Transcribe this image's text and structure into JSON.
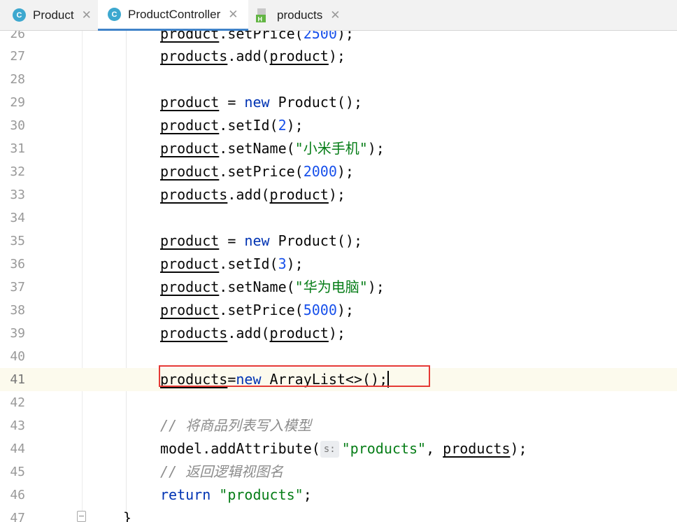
{
  "tabs": [
    {
      "label": "Product",
      "icon": "class-icon",
      "icon_letter": "C",
      "close": "✕"
    },
    {
      "label": "ProductController",
      "icon": "class-icon",
      "icon_letter": "C",
      "close": "✕"
    },
    {
      "label": "products",
      "icon": "html-file-icon",
      "icon_letter": "H",
      "close": "✕"
    }
  ],
  "active_tab": "ProductController",
  "lines": {
    "l26": {
      "no": "26",
      "a": "product",
      "b": ".setPrice(",
      "c": "2500",
      "d": ");"
    },
    "l27": {
      "no": "27",
      "a": "products",
      "b": ".add(",
      "c": "product",
      "d": ");"
    },
    "l28": {
      "no": "28"
    },
    "l29": {
      "no": "29",
      "a": "product",
      "b": " = ",
      "kw": "new",
      "c": " Product();"
    },
    "l30": {
      "no": "30",
      "a": "product",
      "b": ".setId(",
      "c": "2",
      "d": ");"
    },
    "l31": {
      "no": "31",
      "a": "product",
      "b": ".setName(",
      "c": "\"小米手机\"",
      "d": ");"
    },
    "l32": {
      "no": "32",
      "a": "product",
      "b": ".setPrice(",
      "c": "2000",
      "d": ");"
    },
    "l33": {
      "no": "33",
      "a": "products",
      "b": ".add(",
      "c": "product",
      "d": ");"
    },
    "l34": {
      "no": "34"
    },
    "l35": {
      "no": "35",
      "a": "product",
      "b": " = ",
      "kw": "new",
      "c": " Product();"
    },
    "l36": {
      "no": "36",
      "a": "product",
      "b": ".setId(",
      "c": "3",
      "d": ");"
    },
    "l37": {
      "no": "37",
      "a": "product",
      "b": ".setName(",
      "c": "\"华为电脑\"",
      "d": ");"
    },
    "l38": {
      "no": "38",
      "a": "product",
      "b": ".setPrice(",
      "c": "5000",
      "d": ");"
    },
    "l39": {
      "no": "39",
      "a": "products",
      "b": ".add(",
      "c": "product",
      "d": ");"
    },
    "l40": {
      "no": "40"
    },
    "l41": {
      "no": "41",
      "a": "products",
      "b": "=",
      "kw": "new",
      "c": " ArrayList<>();"
    },
    "l42": {
      "no": "42"
    },
    "l43": {
      "no": "43",
      "comment": "// 将商品列表写入模型"
    },
    "l44": {
      "no": "44",
      "a": "model.addAttribute(",
      "hint": "s:",
      "str": "\"products\"",
      "b": ", ",
      "c": "products",
      "d": ");"
    },
    "l45": {
      "no": "45",
      "comment": "// 返回逻辑视图名"
    },
    "l46": {
      "no": "46",
      "kw": "return",
      "str": "\"products\"",
      "d": ";"
    },
    "l47": {
      "no": "47",
      "brace": "}"
    }
  },
  "colors": {
    "keyword": "#0033b3",
    "number": "#1750eb",
    "string": "#067d17",
    "comment": "#8c8c8c",
    "highlight_box": "#e53935",
    "current_line": "#fcfaed",
    "tab_accent": "#4083c9"
  }
}
